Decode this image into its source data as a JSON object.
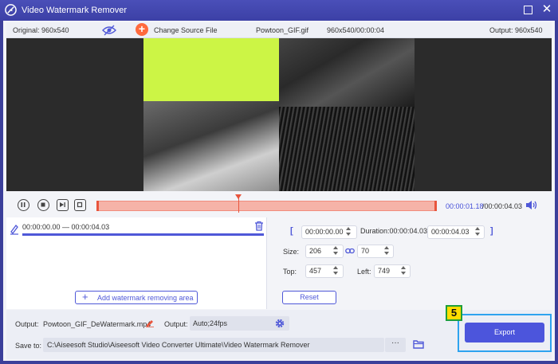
{
  "window": {
    "title": "Video Watermark Remover"
  },
  "infobar": {
    "original": "Original: 960x540",
    "change_source": "Change Source File",
    "file_name": "Powtoon_GIF.gif",
    "file_meta": "960x540/00:00:04",
    "output": "Output: 960x540"
  },
  "playback": {
    "current_time": "00:00:01.18",
    "total_time": "/00:00:04.03"
  },
  "watermark_panel": {
    "range": "00:00:00.00 — 00:00:04.03",
    "add_button": "Add watermark removing area"
  },
  "settings": {
    "start_time": "00:00:00.00",
    "duration": "Duration:00:00:04.03",
    "end_time": "00:00:04.03",
    "size_label": "Size:",
    "size_w": "206",
    "size_h": "70",
    "top_label": "Top:",
    "top_val": "457",
    "left_label": "Left:",
    "left_val": "749",
    "reset": "Reset"
  },
  "bottom": {
    "output_label": "Output:",
    "output_file": "Powtoon_GIF_DeWatermark.mp4",
    "output_format_label": "Output:",
    "output_format": "Auto;24fps",
    "save_to_label": "Save to:",
    "save_path": "C:\\Aiseesoft Studio\\Aiseesoft Video Converter Ultimate\\Video Watermark Remover",
    "more": "···",
    "export": "Export"
  },
  "annotation": {
    "step": "5"
  },
  "colors": {
    "accent": "#4c55dc",
    "timeline": "#f6b3a8",
    "highlight": "#2ea3ef",
    "badge": "#ffdd00"
  }
}
